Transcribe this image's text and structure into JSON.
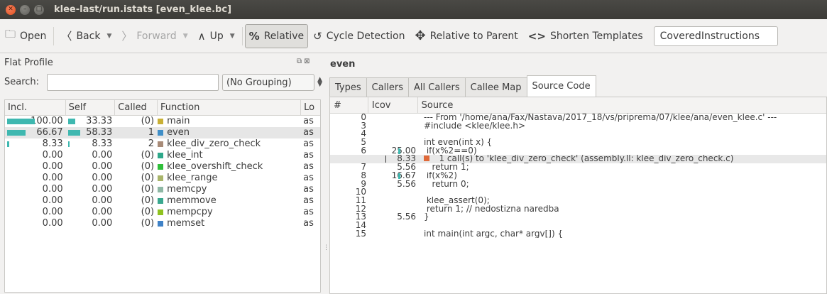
{
  "window": {
    "title": "klee-last/run.istats [even_klee.bc]"
  },
  "toolbar": {
    "open": "Open",
    "back": "Back",
    "forward": "Forward",
    "up": "Up",
    "relative": "Relative",
    "cycle_detection": "Cycle Detection",
    "relative_to_parent": "Relative to Parent",
    "shorten_templates": "Shorten Templates",
    "event_type": "CoveredInstructions"
  },
  "flat_profile": {
    "title": "Flat Profile",
    "search_label": "Search:",
    "search_value": "",
    "grouping": "(No Grouping)",
    "columns": [
      "Incl.",
      "Self",
      "Called",
      "Function",
      "Lo"
    ],
    "rows": [
      {
        "incl": "100.00",
        "incl_frac": 1.0,
        "self": "33.33",
        "self_frac": 0.3333,
        "called": "(0)",
        "func": "main",
        "color": "#c9b036",
        "loc": "as",
        "selected": false
      },
      {
        "incl": "66.67",
        "incl_frac": 0.6667,
        "self": "58.33",
        "self_frac": 0.5833,
        "called": "1",
        "func": "even",
        "color": "#3f8ec7",
        "loc": "as",
        "selected": true
      },
      {
        "incl": "8.33",
        "incl_frac": 0.0833,
        "self": "8.33",
        "self_frac": 0.0833,
        "called": "2",
        "func": "klee_div_zero_check",
        "color": "#a88b78",
        "loc": "as",
        "selected": false
      },
      {
        "incl": "0.00",
        "incl_frac": 0,
        "self": "0.00",
        "self_frac": 0,
        "called": "(0)",
        "func": "klee_int",
        "color": "#2fa88a",
        "loc": "as",
        "selected": false
      },
      {
        "incl": "0.00",
        "incl_frac": 0,
        "self": "0.00",
        "self_frac": 0,
        "called": "(0)",
        "func": "klee_overshift_check",
        "color": "#2fbf3a",
        "loc": "as",
        "selected": false
      },
      {
        "incl": "0.00",
        "incl_frac": 0,
        "self": "0.00",
        "self_frac": 0,
        "called": "(0)",
        "func": "klee_range",
        "color": "#a9b56a",
        "loc": "as",
        "selected": false
      },
      {
        "incl": "0.00",
        "incl_frac": 0,
        "self": "0.00",
        "self_frac": 0,
        "called": "(0)",
        "func": "memcpy",
        "color": "#8fb8a5",
        "loc": "as",
        "selected": false
      },
      {
        "incl": "0.00",
        "incl_frac": 0,
        "self": "0.00",
        "self_frac": 0,
        "called": "(0)",
        "func": "memmove",
        "color": "#3aa88f",
        "loc": "as",
        "selected": false
      },
      {
        "incl": "0.00",
        "incl_frac": 0,
        "self": "0.00",
        "self_frac": 0,
        "called": "(0)",
        "func": "mempcpy",
        "color": "#8fc21f",
        "loc": "as",
        "selected": false
      },
      {
        "incl": "0.00",
        "incl_frac": 0,
        "self": "0.00",
        "self_frac": 0,
        "called": "(0)",
        "func": "memset",
        "color": "#3f82c7",
        "loc": "as",
        "selected": false
      }
    ]
  },
  "detail": {
    "function": "even",
    "tabs": [
      "Types",
      "Callers",
      "All Callers",
      "Callee Map",
      "Source Code"
    ],
    "active_tab": "Source Code",
    "columns": [
      "#",
      "Icov",
      "Source"
    ],
    "rows": [
      {
        "num": "0",
        "icov": "",
        "marker": "",
        "src": "--- From '/home/ana/Fax/Nastava/2017_18/vs/priprema/07/klee/ana/even_klee.c' ---"
      },
      {
        "num": "3",
        "icov": "",
        "marker": "",
        "src": "#include <klee/klee.h>"
      },
      {
        "num": "4",
        "icov": "",
        "marker": "",
        "src": ""
      },
      {
        "num": "5",
        "icov": "",
        "marker": "",
        "src": "int even(int x) {"
      },
      {
        "num": "6",
        "icov": "25.00",
        "marker": "bar",
        "src": " if(x%2==0)"
      },
      {
        "num": "",
        "icov": "8.33",
        "marker": "call",
        "src": "   1 call(s) to 'klee_div_zero_check' (assembly.ll: klee_div_zero_check.c)"
      },
      {
        "num": "7",
        "icov": "5.56",
        "marker": "",
        "src": "   return 1;"
      },
      {
        "num": "8",
        "icov": "16.67",
        "marker": "bar",
        "src": " if(x%2)"
      },
      {
        "num": "9",
        "icov": "5.56",
        "marker": "",
        "src": "   return 0;"
      },
      {
        "num": "10",
        "icov": "",
        "marker": "",
        "src": ""
      },
      {
        "num": "11",
        "icov": "",
        "marker": "",
        "src": " klee_assert(0);"
      },
      {
        "num": "12",
        "icov": "",
        "marker": "",
        "src": " return 1; // nedostizna naredba"
      },
      {
        "num": "13",
        "icov": "5.56",
        "marker": "",
        "src": "}"
      },
      {
        "num": "14",
        "icov": "",
        "marker": "",
        "src": ""
      },
      {
        "num": "15",
        "icov": "",
        "marker": "",
        "src": "int main(int argc, char* argv[]) {"
      }
    ]
  },
  "colors": {
    "bar": "#3fb8b0",
    "call_marker": "#e06a3a",
    "selection": "#e6e6e6"
  }
}
